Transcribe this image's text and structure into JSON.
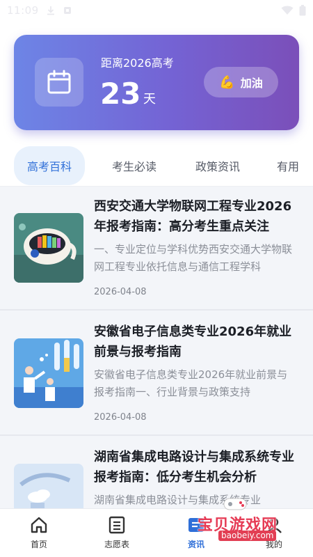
{
  "status_bar": {
    "time": "11:09"
  },
  "countdown": {
    "title": "距离2026高考",
    "days": "23",
    "unit": "天",
    "cheer_emoji": "💪",
    "cheer_label": "加油"
  },
  "tabs": [
    {
      "label": "高考百科",
      "active": true
    },
    {
      "label": "考生必读",
      "active": false
    },
    {
      "label": "政策资讯",
      "active": false
    },
    {
      "label": "有用",
      "active": false
    }
  ],
  "articles": [
    {
      "title": "西安交通大学物联网工程专业2026年报考指南：高分考生重点关注",
      "summary": "一、专业定位与学科优势西安交通大学物联网工程专业依托信息与通信工程学科",
      "date": "2026-04-08"
    },
    {
      "title": "安徽省电子信息类专业2026年就业前景与报考指南",
      "summary": "安徽省电子信息类专业2026年就业前景与报考指南一、行业背景与政策支持",
      "date": "2026-04-08"
    },
    {
      "title": "湖南省集成电路设计与集成系统专业报考指南：低分考生机会分析",
      "summary": "湖南省集成电路设计与集成系统专业",
      "date": ""
    }
  ],
  "bottom_nav": [
    {
      "label": "首页",
      "icon": "home-icon",
      "active": false
    },
    {
      "label": "志愿表",
      "icon": "list-icon",
      "active": false
    },
    {
      "label": "资讯",
      "icon": "news-icon",
      "active": true
    },
    {
      "label": "我的",
      "icon": "user-icon",
      "active": false
    }
  ],
  "watermark": {
    "text": "宝贝游戏网",
    "url": "baobeiy.com"
  },
  "colors": {
    "accent": "#2f6fd8",
    "card_start": "#6d85e6",
    "card_end": "#7b4fb9"
  }
}
